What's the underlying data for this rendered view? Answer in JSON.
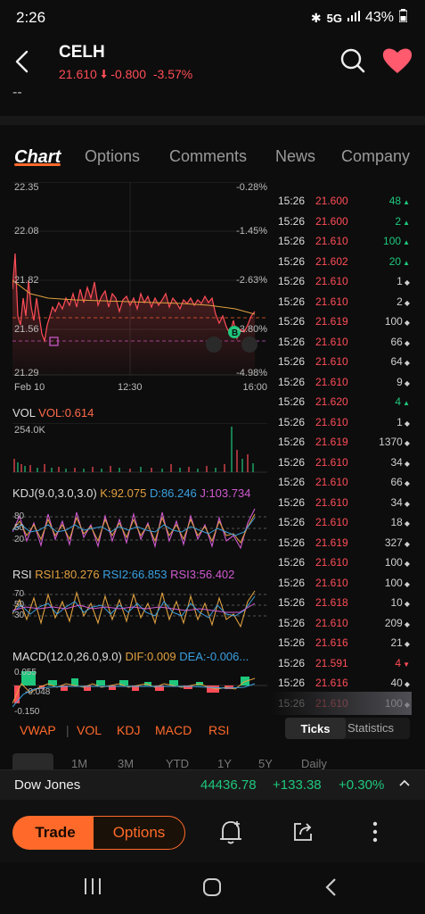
{
  "status": {
    "time": "2:26",
    "network": "5G",
    "battery": "43%"
  },
  "header": {
    "ticker": "CELH",
    "price": "21.610",
    "change": "-0.800",
    "change_pct": "-3.57%",
    "sub": "--"
  },
  "tabs": [
    "Chart",
    "Options",
    "Comments",
    "News",
    "Company"
  ],
  "main_chart": {
    "y_left": [
      "22.35",
      "22.08",
      "21.82",
      "21.56",
      "21.29"
    ],
    "y_right": [
      "-0.28%",
      "-1.45%",
      "-2.63%",
      "-3.80%",
      "-4.98%"
    ],
    "x_labels": [
      "Feb 10",
      "12:30",
      "16:00"
    ]
  },
  "vol": {
    "label": "VOL",
    "value": "VOL:0.614",
    "axis": "254.0K"
  },
  "kdj": {
    "label": "KDJ(9.0,3.0,3.0)",
    "k": "K:92.075",
    "d": "D:86.246",
    "j": "J:103.734",
    "axis": [
      "80",
      "50",
      "20"
    ]
  },
  "rsi": {
    "label": "RSI",
    "r1": "RSI1:80.276",
    "r2": "RSI2:66.853",
    "r3": "RSI3:56.402",
    "axis": [
      "70",
      "50",
      "30"
    ]
  },
  "macd": {
    "label": "MACD(12.0,26.0,9.0)",
    "dif": "DIF:0.009",
    "dea": "DEA:-0.006...",
    "axis": [
      "0.055",
      "-0.048",
      "-0.150"
    ]
  },
  "indicator_tabs": [
    "VWAP",
    "VOL",
    "KDJ",
    "MACD",
    "RSI"
  ],
  "ticks": [
    {
      "time": "15:26",
      "price": "21.600",
      "vol": "48",
      "dir": "up"
    },
    {
      "time": "15:26",
      "price": "21.600",
      "vol": "2",
      "dir": "up"
    },
    {
      "time": "15:26",
      "price": "21.610",
      "vol": "100",
      "dir": "up"
    },
    {
      "time": "15:26",
      "price": "21.602",
      "vol": "20",
      "dir": "up"
    },
    {
      "time": "15:26",
      "price": "21.610",
      "vol": "1",
      "dir": "neutral"
    },
    {
      "time": "15:26",
      "price": "21.610",
      "vol": "2",
      "dir": "neutral"
    },
    {
      "time": "15:26",
      "price": "21.619",
      "vol": "100",
      "dir": "neutral"
    },
    {
      "time": "15:26",
      "price": "21.610",
      "vol": "66",
      "dir": "neutral"
    },
    {
      "time": "15:26",
      "price": "21.610",
      "vol": "64",
      "dir": "neutral"
    },
    {
      "time": "15:26",
      "price": "21.610",
      "vol": "9",
      "dir": "neutral"
    },
    {
      "time": "15:26",
      "price": "21.620",
      "vol": "4",
      "dir": "up"
    },
    {
      "time": "15:26",
      "price": "21.610",
      "vol": "1",
      "dir": "neutral"
    },
    {
      "time": "15:26",
      "price": "21.619",
      "vol": "1370",
      "dir": "neutral"
    },
    {
      "time": "15:26",
      "price": "21.610",
      "vol": "34",
      "dir": "neutral"
    },
    {
      "time": "15:26",
      "price": "21.610",
      "vol": "66",
      "dir": "neutral"
    },
    {
      "time": "15:26",
      "price": "21.610",
      "vol": "34",
      "dir": "neutral"
    },
    {
      "time": "15:26",
      "price": "21.610",
      "vol": "18",
      "dir": "neutral"
    },
    {
      "time": "15:26",
      "price": "21.619",
      "vol": "327",
      "dir": "neutral"
    },
    {
      "time": "15:26",
      "price": "21.610",
      "vol": "100",
      "dir": "neutral"
    },
    {
      "time": "15:26",
      "price": "21.610",
      "vol": "100",
      "dir": "neutral"
    },
    {
      "time": "15:26",
      "price": "21.618",
      "vol": "10",
      "dir": "neutral"
    },
    {
      "time": "15:26",
      "price": "21.610",
      "vol": "209",
      "dir": "neutral"
    },
    {
      "time": "15:26",
      "price": "21.616",
      "vol": "21",
      "dir": "neutral"
    },
    {
      "time": "15:26",
      "price": "21.591",
      "vol": "4",
      "dir": "down"
    },
    {
      "time": "15:26",
      "price": "21.616",
      "vol": "40",
      "dir": "neutral"
    },
    {
      "time": "15:26",
      "price": "21.610",
      "vol": "100",
      "dir": "neutral"
    }
  ],
  "ticks_toggle": {
    "ticks": "Ticks",
    "statistics": "Statistics"
  },
  "ranges": [
    "1M",
    "3M",
    "YTD",
    "1Y",
    "5Y",
    "Daily"
  ],
  "index": {
    "name": "Dow Jones",
    "value": "44436.78",
    "change": "+133.38",
    "pct": "+0.30%"
  },
  "actions": {
    "trade": "Trade",
    "options": "Options"
  },
  "colors": {
    "accent": "#ff6a2a",
    "down": "#ff4d57",
    "up": "#1fc77c"
  }
}
